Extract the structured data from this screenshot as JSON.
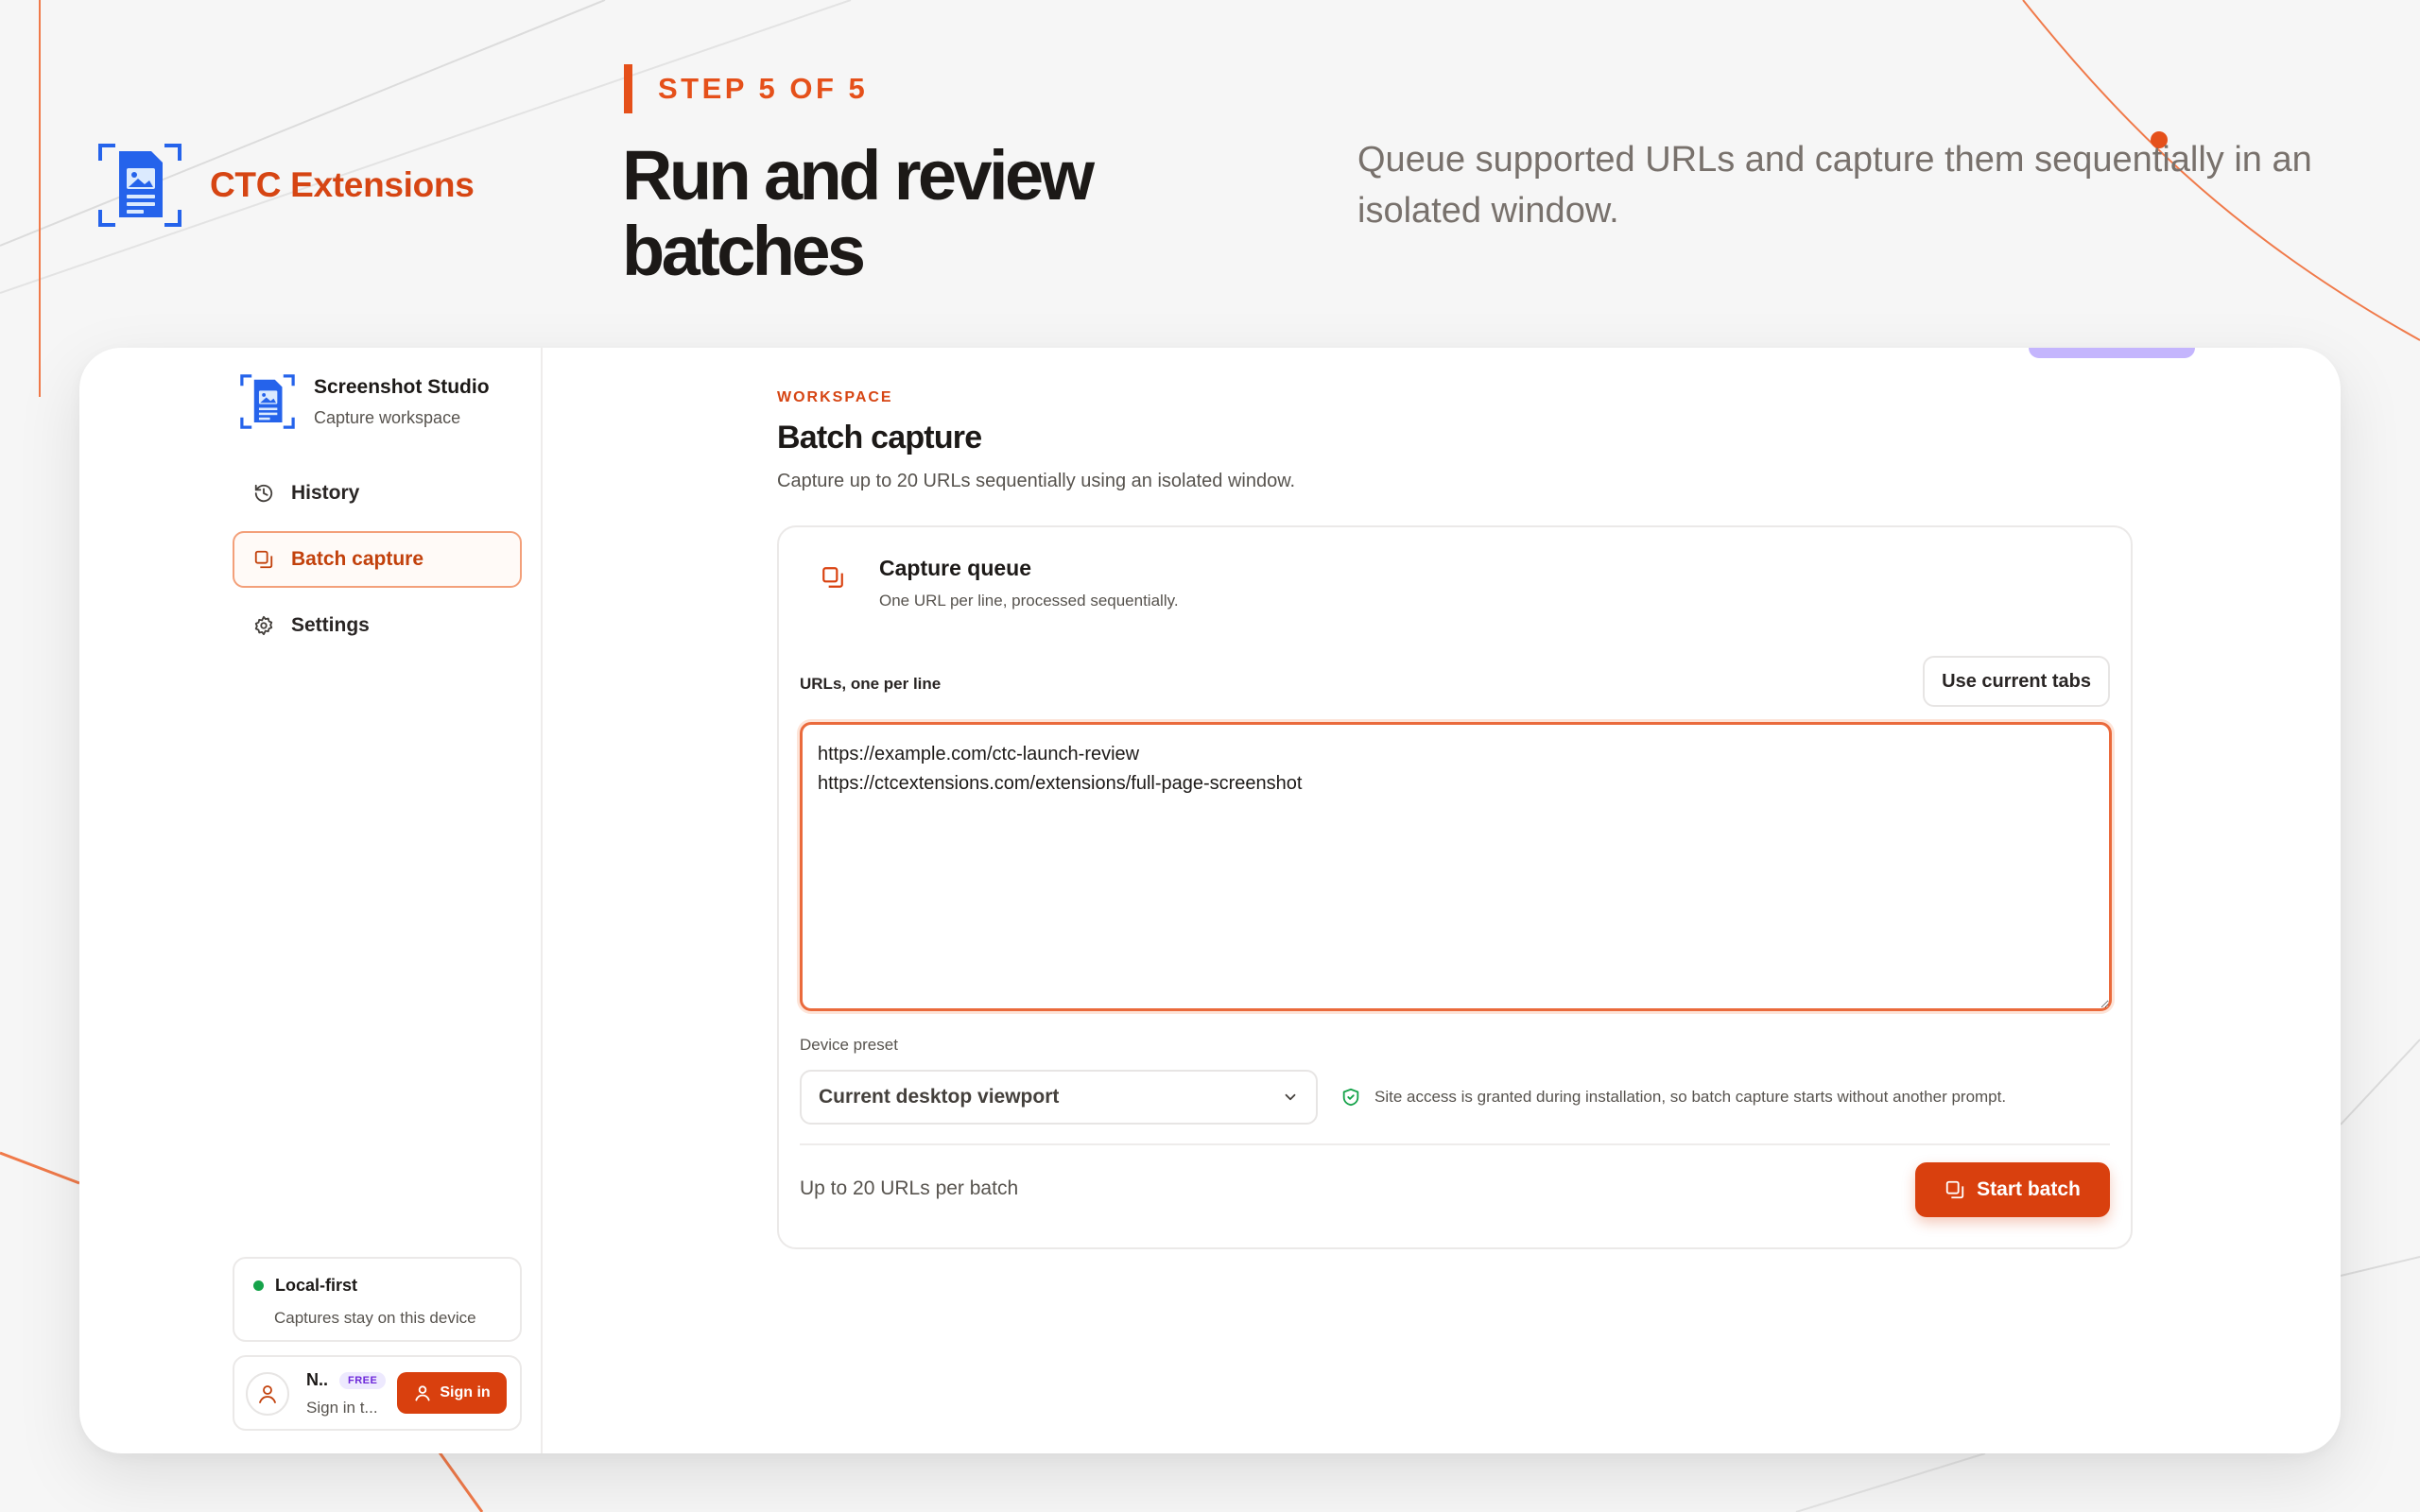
{
  "brand": {
    "name": "CTC Extensions",
    "logo_icon": "document-image-icon"
  },
  "step": {
    "label": "STEP 5 OF 5"
  },
  "hero": {
    "title": "Run and review batches",
    "subtitle": "Queue supported URLs and capture them sequentially in an isolated window."
  },
  "sidebar": {
    "app_title": "Screenshot Studio",
    "app_subtitle": "Capture workspace",
    "nav": [
      {
        "label": "History",
        "icon": "history-icon",
        "active": false
      },
      {
        "label": "Batch capture",
        "icon": "batch-copy-icon",
        "active": true
      },
      {
        "label": "Settings",
        "icon": "gear-icon",
        "active": false
      }
    ],
    "local": {
      "title": "Local-first",
      "subtitle": "Captures stay on this device"
    },
    "user": {
      "name": "N..",
      "badge": "FREE",
      "subtitle": "Sign in t...",
      "signin_label": "Sign in"
    }
  },
  "main": {
    "eyebrow": "WORKSPACE",
    "title": "Batch capture",
    "subtitle": "Capture up to 20 URLs sequentially using an isolated window.",
    "card": {
      "title": "Capture queue",
      "subtitle": "One URL per line, processed sequentially.",
      "urls_label": "URLs, one per line",
      "use_tabs_label": "Use current tabs",
      "urls_value": "https://example.com/ctc-launch-review\nhttps://ctcextensions.com/extensions/full-page-screenshot",
      "preset_label": "Device preset",
      "preset_value": "Current desktop viewport",
      "notice": "Site access is granted during installation, so batch capture starts without another prompt.",
      "footer_note": "Up to 20 URLs per batch",
      "start_label": "Start batch"
    }
  },
  "colors": {
    "accent": "#d9400e",
    "brand_text": "#d64513",
    "logo_blue": "#2563eb",
    "badge_purple": "#6d28d9",
    "status_green": "#16a34a"
  }
}
